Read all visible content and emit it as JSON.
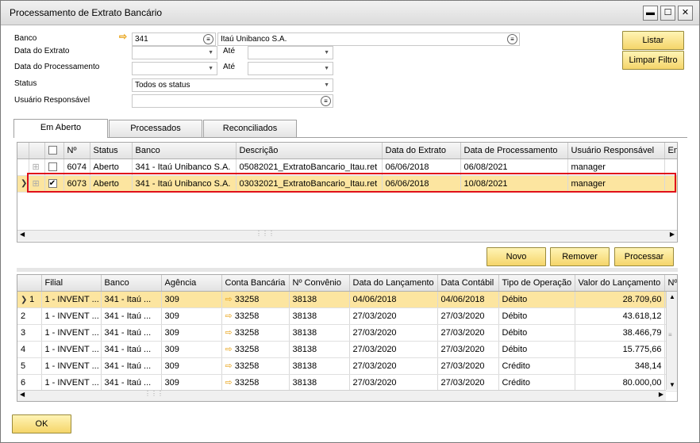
{
  "window": {
    "title": "Processamento de Extrato Bancário",
    "min": "▬",
    "max": "☐",
    "close": "✕"
  },
  "form": {
    "banco_label": "Banco",
    "banco_code": "341",
    "banco_name": "Itaú Unibanco  S.A.",
    "data_extrato_label": "Data do Extrato",
    "ate1_label": "Até",
    "data_proc_label": "Data do Processamento",
    "ate2_label": "Até",
    "status_label": "Status",
    "status_value": "Todos os status",
    "usuario_label": "Usuário Responsável"
  },
  "buttons": {
    "listar": "Listar",
    "limpar": "Limpar Filtro",
    "novo": "Novo",
    "remover": "Remover",
    "processar": "Processar",
    "ok": "OK"
  },
  "tabs": [
    "Em Aberto",
    "Processados",
    "Reconciliados"
  ],
  "top_grid": {
    "headers": [
      "Nº",
      "Status",
      "Banco",
      "Descrição",
      "Data do Extrato",
      "Data de Processamento",
      "Usuário Responsável",
      "En"
    ],
    "rows": [
      {
        "checked": false,
        "cells": [
          "6074",
          "Aberto",
          "341 - Itaú Unibanco  S.A.",
          "05082021_ExtratoBancario_Itau.ret",
          "06/06/2018",
          "06/08/2021",
          "manager"
        ]
      },
      {
        "checked": true,
        "cells": [
          "6073",
          "Aberto",
          "341 - Itaú Unibanco  S.A.",
          "03032021_ExtratoBancario_Itau.ret",
          "06/06/2018",
          "10/08/2021",
          "manager"
        ]
      }
    ]
  },
  "bottom_grid": {
    "headers": [
      "Filial",
      "Banco",
      "Agência",
      "Conta Bancária",
      "Nº Convênio",
      "Data do Lançamento",
      "Data Contábil",
      "Tipo de Operação",
      "Valor do Lançamento",
      "Nº"
    ],
    "rows": [
      [
        "1",
        "1 - INVENT ...",
        "341 - Itaú ...",
        "309",
        "33258",
        "38138",
        "04/06/2018",
        "04/06/2018",
        "Débito",
        "28.709,60"
      ],
      [
        "2",
        "1 - INVENT ...",
        "341 - Itaú ...",
        "309",
        "33258",
        "38138",
        "27/03/2020",
        "27/03/2020",
        "Débito",
        "43.618,12"
      ],
      [
        "3",
        "1 - INVENT ...",
        "341 - Itaú ...",
        "309",
        "33258",
        "38138",
        "27/03/2020",
        "27/03/2020",
        "Débito",
        "38.466,79"
      ],
      [
        "4",
        "1 - INVENT ...",
        "341 - Itaú ...",
        "309",
        "33258",
        "38138",
        "27/03/2020",
        "27/03/2020",
        "Débito",
        "15.775,66"
      ],
      [
        "5",
        "1 - INVENT ...",
        "341 - Itaú ...",
        "309",
        "33258",
        "38138",
        "27/03/2020",
        "27/03/2020",
        "Crédito",
        "348,14"
      ],
      [
        "6",
        "1 - INVENT ...",
        "341 - Itaú ...",
        "309",
        "33258",
        "38138",
        "27/03/2020",
        "27/03/2020",
        "Crédito",
        "80.000,00"
      ]
    ]
  }
}
